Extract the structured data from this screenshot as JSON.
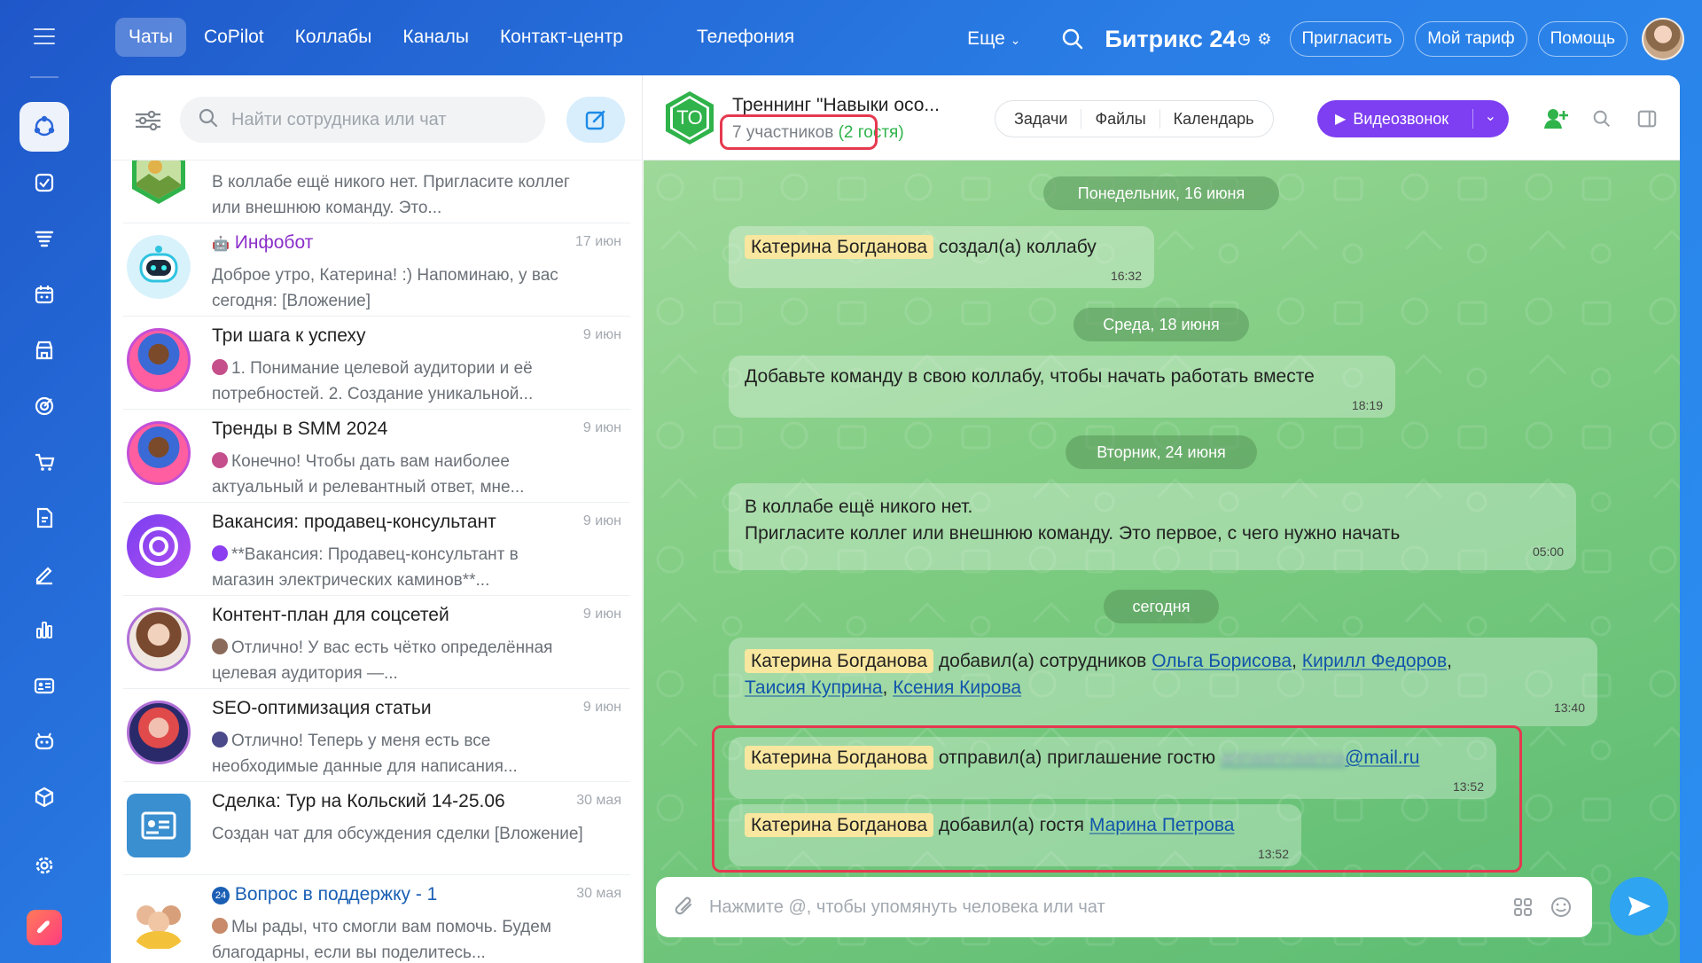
{
  "topnav": {
    "items": [
      "Чаты",
      "CoPilot",
      "Коллабы",
      "Каналы",
      "Контакт-центр",
      "Телефония"
    ],
    "more_label": "Еще",
    "brand": "Битрикс 24",
    "invite_label": "Пригласить",
    "tariff_label": "Мой тариф",
    "help_label": "Помощь"
  },
  "search": {
    "placeholder": "Найти сотрудника или чат"
  },
  "chat_list": [
    {
      "title": "",
      "date": "",
      "preview": "В коллабе ещё никого нет. Пригласите коллег или внешнюю команду. Это...",
      "avatar": "landscape"
    },
    {
      "title": "Инфобот",
      "date": "17 июн",
      "preview": "Доброе утро, Катерина! :) Напоминаю, у вас сегодня: [Вложение]",
      "avatar": "bot"
    },
    {
      "title": "Три шага к успеху",
      "date": "9 июн",
      "preview": "1. Понимание целевой аудитории и её потребностей. 2. Создание уникальной...",
      "avatar": "person-pink"
    },
    {
      "title": "Тренды в SMM 2024",
      "date": "9 июн",
      "preview": "Конечно! Чтобы дать вам наиболее актуальный и релевантный ответ, мне...",
      "avatar": "person-pink"
    },
    {
      "title": "Вакансия: продавец-консультант",
      "date": "9 июн",
      "preview": "**Вакансия: Продавец-консультант в магазин электрических каминов**...",
      "avatar": "copilot"
    },
    {
      "title": "Контент-план для соцсетей",
      "date": "9 июн",
      "preview": "Отлично! У вас есть чётко определённая целевая аудитория —...",
      "avatar": "woman"
    },
    {
      "title": "SEO-оптимизация статьи",
      "date": "9 июн",
      "preview": "Отлично! Теперь у меня есть все необходимые данные для написания...",
      "avatar": "woman-neon"
    },
    {
      "title": "Сделка: Тур на Кольский 14-25.06",
      "date": "30 мая",
      "preview": "Создан чат для обсуждения сделки [Вложение]",
      "avatar": "deal"
    },
    {
      "title": "Вопрос в поддержку - 1",
      "date": "30 мая",
      "preview": "Мы рады, что смогли вам помочь. Будем благодарны, если вы поделитесь...",
      "avatar": "group"
    }
  ],
  "chat": {
    "avatar_initials": "ТО",
    "title": "Треннинг \"Навыки осо...",
    "participants": "7 участников",
    "guests": "(2 гостя)",
    "tabs": [
      "Задачи",
      "Файлы",
      "Календарь"
    ],
    "video_label": "Видеозвонок",
    "composer_placeholder": "Нажмите @, чтобы упомянуть человека или чат"
  },
  "messages": {
    "date1": "Понедельник, 16 июня",
    "m1": {
      "name": "Катерина Богданова",
      "text": "создал(а) коллабу",
      "time": "16:32"
    },
    "date2": "Среда, 18 июня",
    "m2": {
      "text": "Добавьте команду в свою коллабу, чтобы начать работать вместе",
      "time": "18:19"
    },
    "date3": "Вторник, 24 июня",
    "m3": {
      "line1": "В коллабе ещё никого нет.",
      "line2": "Пригласите коллег или внешнюю команду. Это первое, с чего нужно начать",
      "time": "05:00"
    },
    "date4": "сегодня",
    "m4": {
      "name": "Катерина Богданова",
      "text": "добавил(а) сотрудников",
      "users": [
        "Ольга Борисова",
        "Кирилл Федоров",
        "Таисия Куприна",
        "Ксения Кирова"
      ],
      "time": "13:40"
    },
    "m5": {
      "name": "Катерина Богданова",
      "text": "отправил(а) приглашение гостю",
      "email_hidden": "annaannaanna",
      "email_domain": "@mail.ru",
      "time": "13:52"
    },
    "m6": {
      "name": "Катерина Богданова",
      "text": "добавил(а) гостя",
      "guest": "Марина Петрова",
      "time": "13:52"
    }
  }
}
